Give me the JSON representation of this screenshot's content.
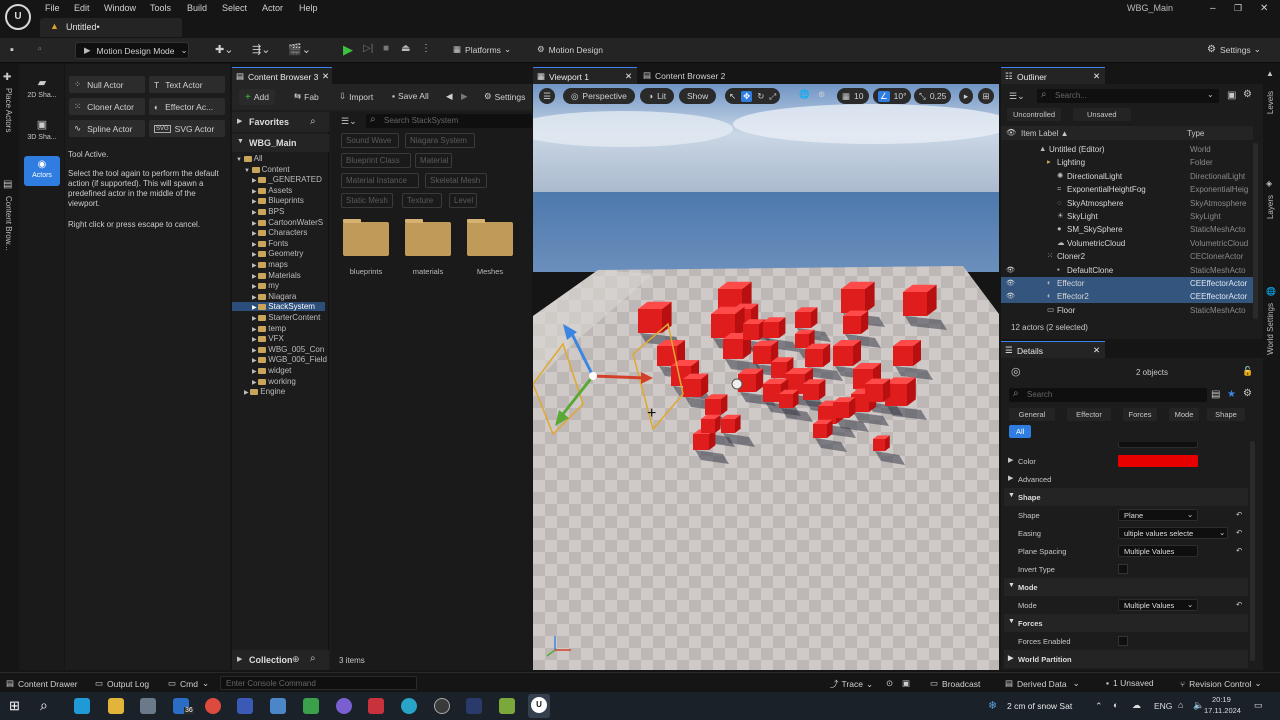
{
  "menu": {
    "items": [
      "File",
      "Edit",
      "Window",
      "Tools",
      "Build",
      "Select",
      "Actor",
      "Help"
    ],
    "project_name": "WBG_Main"
  },
  "document_tab": "Untitled•",
  "toolbar": {
    "mode_label": "Motion Design Mode",
    "platforms_label": "Platforms",
    "motion_design_label": "Motion Design",
    "settings_label": "Settings"
  },
  "left_rail": {
    "place_actors": "Place Actors",
    "content_browser": "Content Brow..."
  },
  "mode_palette": {
    "items": [
      {
        "label": "2D Sha...",
        "icon": "2d-shape-icon"
      },
      {
        "label": "3D Sha...",
        "icon": "3d-shape-icon"
      },
      {
        "label": "Actors",
        "icon": "actors-icon"
      }
    ]
  },
  "actor_tools": {
    "buttons": [
      {
        "label": "Null Actor",
        "icon": "null-actor-icon"
      },
      {
        "label": "Text Actor",
        "icon": "text-actor-icon"
      },
      {
        "label": "Cloner Actor",
        "icon": "cloner-icon"
      },
      {
        "label": "Effector Ac...",
        "icon": "effector-icon"
      },
      {
        "label": "Spline Actor",
        "icon": "spline-icon"
      },
      {
        "label": "SVG Actor",
        "icon": "svg-icon"
      }
    ],
    "tool_active": "Tool Active.",
    "hint1": "Select the tool again to perform the default action (if supported). This will spawn a predefined actor in the middle of the viewport.",
    "hint2": "Right click or press escape to cancel."
  },
  "content_browser": {
    "tab_label": "Content Browser 3",
    "add_label": "Add",
    "fab_label": "Fab",
    "import_label": "Import",
    "save_all_label": "Save All",
    "settings_label": "Settings",
    "favorites_label": "Favorites",
    "root_label": "WBG_Main",
    "search_placeholder": "Search StackSystem",
    "tree": {
      "all": "All",
      "content": "Content",
      "folders": [
        "_GENERATED",
        "Assets",
        "Blueprints",
        "BPS",
        "CartoonWaterS",
        "Characters",
        "Fonts",
        "Geometry",
        "maps",
        "Materials",
        "my",
        "Niagara",
        "StackSystem",
        "StarterContent",
        "temp",
        "VFX",
        "WBG_005_Con",
        "WGB_006_Field",
        "widget",
        "working"
      ],
      "engine": "Engine"
    },
    "filters": [
      "Sound Wave",
      "Niagara System",
      "Blueprint Class",
      "Material",
      "Material Instance",
      "Skeletal Mesh",
      "Static Mesh",
      "Texture",
      "Level"
    ],
    "assets": [
      "blueprints",
      "materials",
      "Meshes"
    ],
    "collection_label": "Collection",
    "items_count": "3 items"
  },
  "viewport": {
    "tab_label": "Viewport 1",
    "second_tab_label": "Content Browser 2",
    "perspective_label": "Perspective",
    "lit_label": "Lit",
    "show_label": "Show",
    "grid_snap": "10",
    "rot_snap": "10°",
    "scale_snap": "0,25"
  },
  "outliner": {
    "tab_label": "Outliner",
    "search_placeholder": "Search...",
    "uncontrolled_label": "Uncontrolled",
    "unsaved_label": "Unsaved",
    "col_label": "Item Label ▲",
    "col_type": "Type",
    "rows": [
      {
        "name": "Untitled (Editor)",
        "type": "World",
        "selected": false
      },
      {
        "name": "Lighting",
        "type": "Folder",
        "selected": false
      },
      {
        "name": "DirectionalLight",
        "type": "DirectionalLight",
        "selected": false
      },
      {
        "name": "ExponentialHeightFog",
        "type": "ExponentialHeig",
        "selected": false
      },
      {
        "name": "SkyAtmosphere",
        "type": "SkyAtmosphere",
        "selected": false
      },
      {
        "name": "SkyLight",
        "type": "SkyLight",
        "selected": false
      },
      {
        "name": "SM_SkySphere",
        "type": "StaticMeshActo",
        "selected": false
      },
      {
        "name": "VolumetricCloud",
        "type": "VolumetricCloud",
        "selected": false
      },
      {
        "name": "Cloner2",
        "type": "CEClonerActor",
        "selected": false
      },
      {
        "name": "DefaultClone",
        "type": "StaticMeshActo",
        "selected": false
      },
      {
        "name": "Effector",
        "type": "CEEffectorActor",
        "selected": true
      },
      {
        "name": "Effector2",
        "type": "CEEffectorActor",
        "selected": true
      },
      {
        "name": "Floor",
        "type": "StaticMeshActo",
        "selected": false
      }
    ],
    "footer": "12 actors (2 selected)"
  },
  "details": {
    "tab_label": "Details",
    "objects_label": "2 objects",
    "search_placeholder": "Search",
    "filter_tabs": [
      "General",
      "Effector",
      "Forces",
      "Mode",
      "Shape"
    ],
    "all_label": "All",
    "rows": {
      "color": "Color",
      "advanced": "Advanced",
      "shape_section": "Shape",
      "shape_label": "Shape",
      "shape_value": "Plane",
      "easing_label": "Easing",
      "easing_value": "ultiple values selecte",
      "plane_spacing_label": "Plane Spacing",
      "plane_spacing_value": "Multiple Values",
      "invert_type_label": "Invert Type",
      "mode_section": "Mode",
      "mode_label": "Mode",
      "mode_value": "Multiple Values",
      "forces_section": "Forces",
      "forces_enabled_label": "Forces Enabled",
      "world_partition": "World Partition"
    },
    "color_value": "#e60000"
  },
  "right_rail": {
    "levels": "Levels",
    "layers": "Layers",
    "world_settings": "World Settings"
  },
  "statusbar": {
    "content_drawer": "Content Drawer",
    "output_log": "Output Log",
    "cmd": "Cmd",
    "console_placeholder": "Enter Console Command",
    "trace": "Trace",
    "broadcast": "Broadcast",
    "derived_data": "Derived Data",
    "unsaved": "1 Unsaved",
    "revision_control": "Revision Control"
  },
  "taskbar": {
    "weather": "2 cm of snow Sat",
    "lang": "ENG",
    "time": "20:19",
    "date": "17.11.2024",
    "badge": "36"
  }
}
